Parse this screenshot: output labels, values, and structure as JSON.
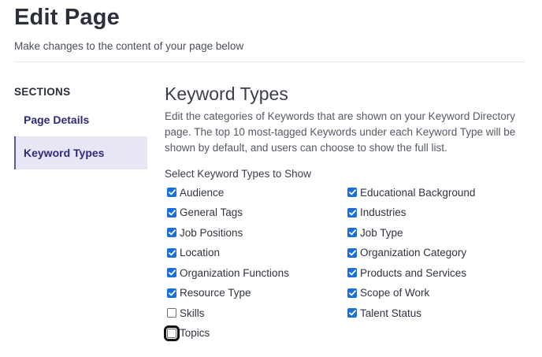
{
  "header": {
    "title": "Edit Page",
    "subtitle": "Make changes to the content of your page below"
  },
  "sidebar": {
    "heading": "SECTIONS",
    "items": [
      {
        "label": "Page Details",
        "active": false
      },
      {
        "label": "Keyword Types",
        "active": true
      }
    ]
  },
  "main": {
    "title": "Keyword Types",
    "description": "Edit the categories of Keywords that are shown on your Keyword Directory page. The top 10 most-tagged Keywords under each Keyword Type will be shown by default, and users can choose to show the full list.",
    "select_label": "Select Keyword Types to Show",
    "options_left": [
      {
        "label": "Audience",
        "checked": true
      },
      {
        "label": "General Tags",
        "checked": true
      },
      {
        "label": "Job Positions",
        "checked": true
      },
      {
        "label": "Location",
        "checked": true
      },
      {
        "label": "Organization Functions",
        "checked": true
      },
      {
        "label": "Resource Type",
        "checked": true
      },
      {
        "label": "Skills",
        "checked": false
      },
      {
        "label": "Topics",
        "checked": false,
        "focused": true
      }
    ],
    "options_right": [
      {
        "label": "Educational Background",
        "checked": true
      },
      {
        "label": "Industries",
        "checked": true
      },
      {
        "label": "Job Type",
        "checked": true
      },
      {
        "label": "Organization Category",
        "checked": true
      },
      {
        "label": "Products and Services",
        "checked": true
      },
      {
        "label": "Scope of Work",
        "checked": true
      },
      {
        "label": "Talent Status",
        "checked": true
      }
    ]
  },
  "colors": {
    "accent": "#1a6fd8",
    "nav_text": "#2c2a7a",
    "nav_active_bg": "#e7e6f5"
  },
  "icons": {
    "checkbox_checked": "checkmark-icon"
  }
}
